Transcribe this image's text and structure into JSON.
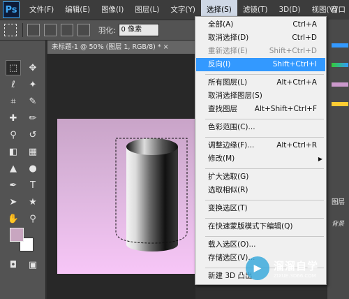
{
  "app": {
    "logo": "Ps"
  },
  "menubar": {
    "items": [
      "文件(F)",
      "编辑(E)",
      "图像(I)",
      "图层(L)",
      "文字(Y)",
      "选择(S)",
      "滤镜(T)",
      "3D(D)",
      "视图(V)"
    ],
    "window_partial": "窗口"
  },
  "options": {
    "feather_label": "羽化:",
    "feather_value": "0 像素"
  },
  "document": {
    "tab_title": "未标题-1 @ 50% (图层 1, RGB/8) * ×"
  },
  "select_menu": {
    "items": [
      {
        "label": "全部(A)",
        "shortcut": "Ctrl+A"
      },
      {
        "label": "取消选择(D)",
        "shortcut": "Ctrl+D"
      },
      {
        "label": "重新选择(E)",
        "shortcut": "Shift+Ctrl+D"
      },
      {
        "label": "反向(I)",
        "shortcut": "Shift+Ctrl+I"
      },
      {
        "label": "所有图层(L)",
        "shortcut": "Alt+Ctrl+A"
      },
      {
        "label": "取消选择图层(S)",
        "shortcut": ""
      },
      {
        "label": "查找图层",
        "shortcut": "Alt+Shift+Ctrl+F"
      },
      {
        "label": "色彩范围(C)...",
        "shortcut": ""
      },
      {
        "label": "调整边缘(F)...",
        "shortcut": "Alt+Ctrl+R"
      },
      {
        "label": "修改(M)",
        "shortcut": ""
      },
      {
        "label": "扩大选取(G)",
        "shortcut": ""
      },
      {
        "label": "选取相似(R)",
        "shortcut": ""
      },
      {
        "label": "变换选区(T)",
        "shortcut": ""
      },
      {
        "label": "在快速蒙版模式下编辑(Q)",
        "shortcut": ""
      },
      {
        "label": "载入选区(O)...",
        "shortcut": ""
      },
      {
        "label": "存储选区(V)...",
        "shortcut": ""
      },
      {
        "label": "新建 3D 凸出",
        "shortcut": ""
      }
    ]
  },
  "right_panel": {
    "tab_label": "图层",
    "layer_label": "背景"
  },
  "watermark": {
    "title": "溜溜自学",
    "url": "ZIXUE.3D66.COM"
  },
  "colors": {
    "foreground": "#c8a6c0",
    "background": "#ffffff",
    "highlight": "#3399ff"
  }
}
